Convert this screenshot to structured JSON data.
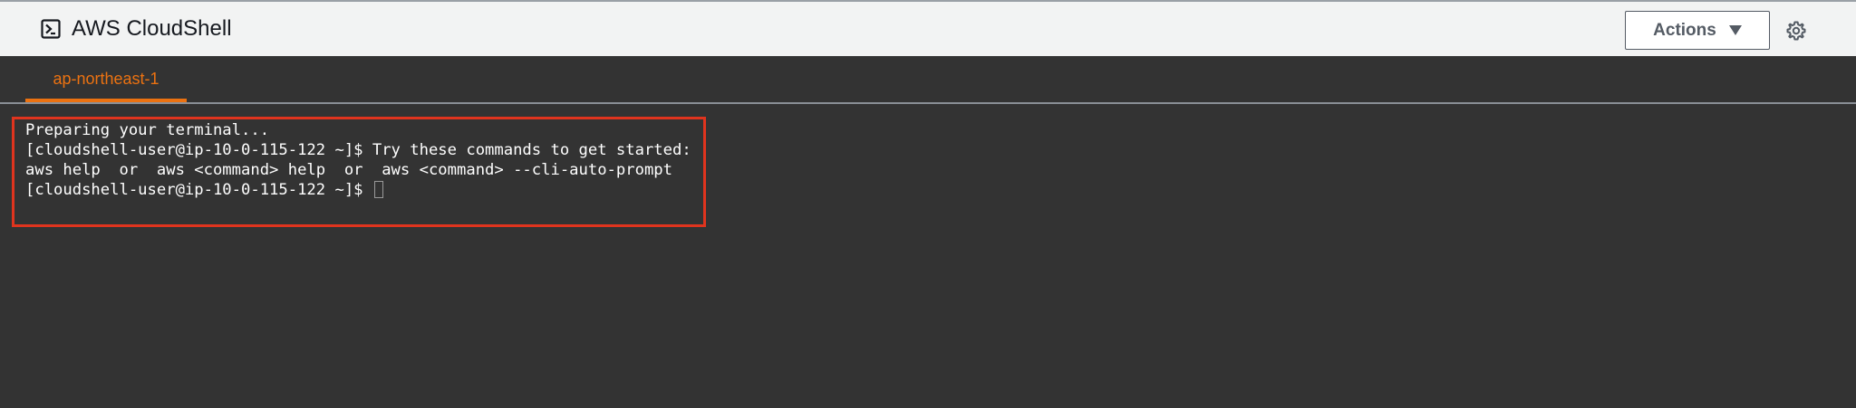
{
  "header": {
    "title": "AWS CloudShell",
    "icon": "terminal-icon",
    "actions_label": "Actions",
    "settings_icon": "gear-icon"
  },
  "tabs": [
    {
      "label": "ap-northeast-1",
      "active": true
    }
  ],
  "terminal": {
    "lines": [
      "Preparing your terminal...",
      "[cloudshell-user@ip-10-0-115-122 ~]$ Try these commands to get started:",
      "aws help  or  aws <command> help  or  aws <command> --cli-auto-prompt",
      "[cloudshell-user@ip-10-0-115-122 ~]$ "
    ]
  },
  "colors": {
    "accent": "#ec7211",
    "terminal_bg": "#333333",
    "header_bg": "#f2f3f3",
    "highlight": "#e0341e"
  }
}
